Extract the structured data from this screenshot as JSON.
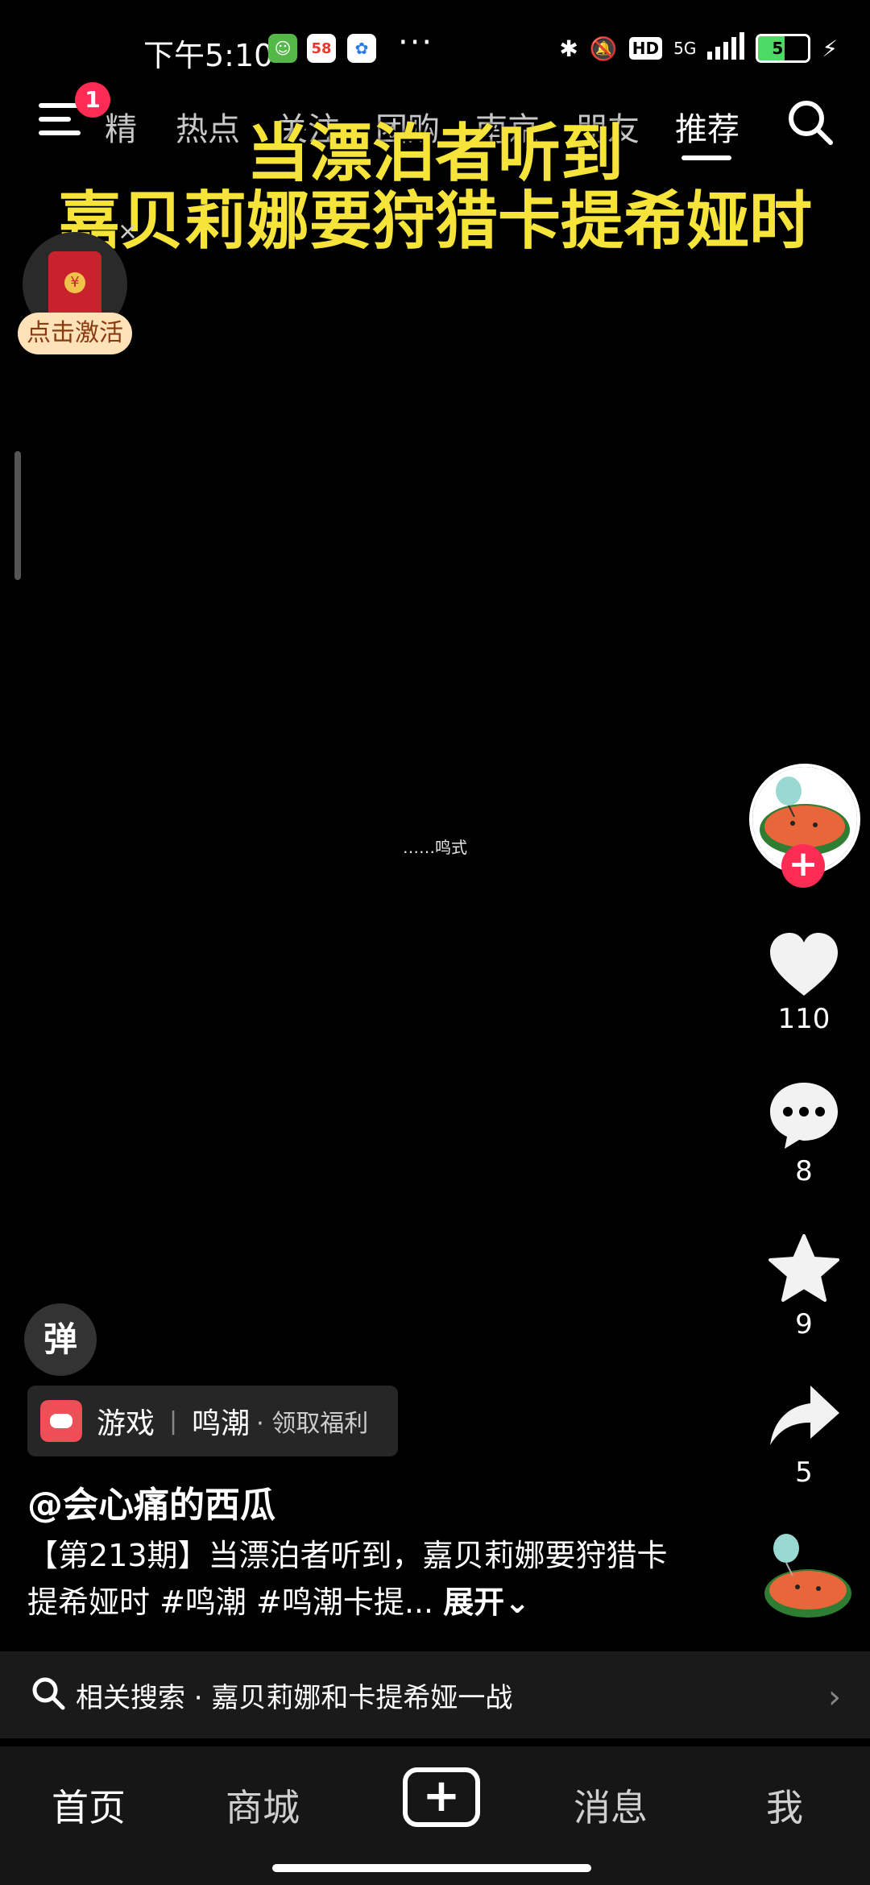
{
  "status_bar": {
    "time": "下午5:10",
    "icons": [
      "wechat-icon",
      "58-icon",
      "baidu-icon"
    ],
    "dots": "···",
    "net_label": "5G",
    "hd_label": "HD",
    "battery": "52"
  },
  "top_nav": {
    "badge_count": "1",
    "tabs": [
      {
        "label": "精选"
      },
      {
        "label": "热点"
      },
      {
        "label": "关注"
      },
      {
        "label": "团购"
      },
      {
        "label": "南京"
      },
      {
        "label": "朋友"
      },
      {
        "label": "推荐"
      }
    ],
    "active_tab": "推荐"
  },
  "video_overlay": {
    "title_line1": "当漂泊者听到",
    "title_line2": "嘉贝莉娜要狩猎卡提希娅时",
    "center_caption": "……鸣式"
  },
  "red_packet": {
    "label": "点击激活",
    "close": "×",
    "seal": "¥"
  },
  "actions": {
    "likes": "110",
    "comments": "8",
    "favorites": "9",
    "shares": "5",
    "follow": "+"
  },
  "info": {
    "danmu": "弹",
    "game_tag": "游戏",
    "game_name": "鸣潮",
    "game_cta": "· 领取福利",
    "author": "@会心痛的西瓜",
    "desc": "【第213期】当漂泊者听到，嘉贝莉娜要狩猎卡提希娅时 #鸣潮 #鸣潮卡提...",
    "expand": "展开"
  },
  "related_search": {
    "text": "相关搜索 · 嘉贝莉娜和卡提希娅一战",
    "chevron": "›"
  },
  "bottom_nav": {
    "home": "首页",
    "mall": "商城",
    "plus": "+",
    "messages": "消息",
    "me": "我"
  },
  "colors": {
    "accent": "#fe2c55",
    "title_yellow": "#f6e43a"
  }
}
